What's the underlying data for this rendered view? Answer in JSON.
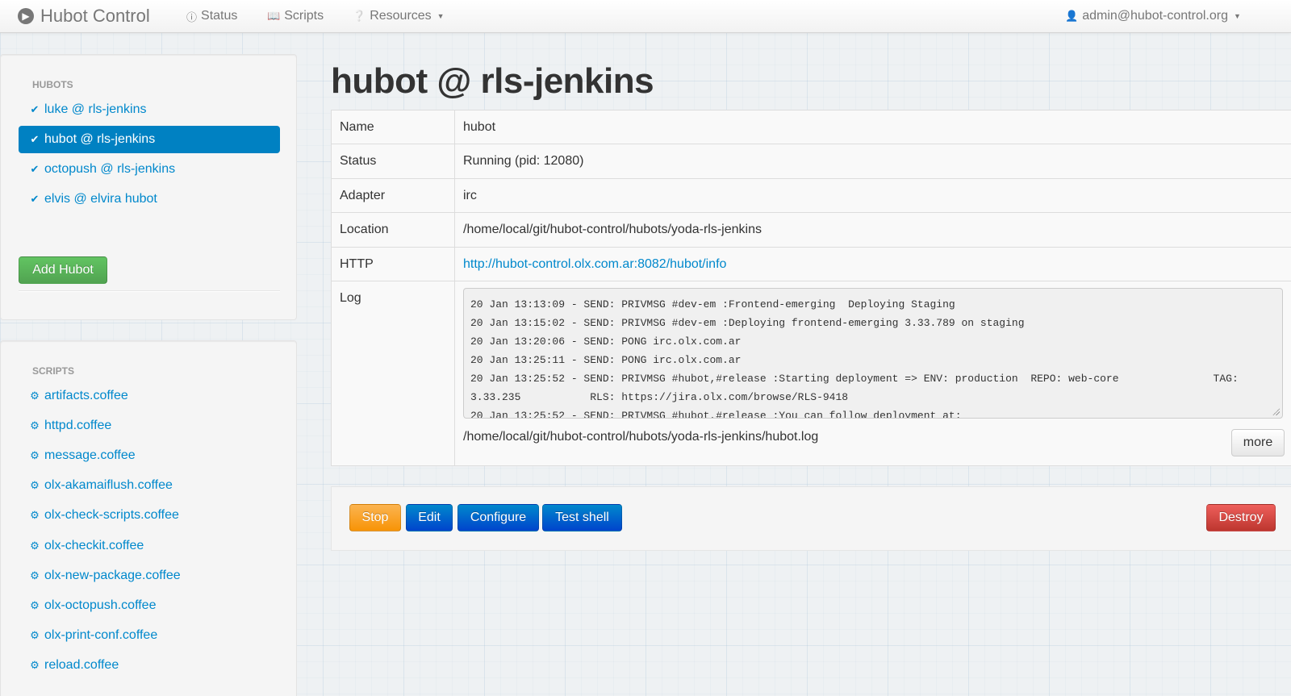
{
  "navbar": {
    "brand": "Hubot Control",
    "items": [
      {
        "label": "Status",
        "icon": "info-circle-icon"
      },
      {
        "label": "Scripts",
        "icon": "book-icon"
      },
      {
        "label": "Resources",
        "icon": "question-circle-icon"
      }
    ],
    "user": "admin@hubot-control.org"
  },
  "sidebar": {
    "hubots_header": "HUBOTS",
    "hubots": [
      {
        "label": "luke @ rls-jenkins",
        "active": false
      },
      {
        "label": "hubot @ rls-jenkins",
        "active": true
      },
      {
        "label": "octopush @ rls-jenkins",
        "active": false
      },
      {
        "label": "elvis @ elvira hubot",
        "active": false
      }
    ],
    "add_hubot_label": "Add Hubot",
    "scripts_header": "SCRIPTS",
    "scripts": [
      "artifacts.coffee",
      "httpd.coffee",
      "message.coffee",
      "olx-akamaiflush.coffee",
      "olx-check-scripts.coffee",
      "olx-checkit.coffee",
      "olx-new-package.coffee",
      "olx-octopush.coffee",
      "olx-print-conf.coffee",
      "reload.coffee"
    ]
  },
  "main": {
    "title": "hubot @ rls-jenkins",
    "details": {
      "name_label": "Name",
      "name_value": "hubot",
      "status_label": "Status",
      "status_value": "Running (pid: 12080)",
      "adapter_label": "Adapter",
      "adapter_value": "irc",
      "location_label": "Location",
      "location_value": "/home/local/git/hubot-control/hubots/yoda-rls-jenkins",
      "http_label": "HTTP",
      "http_value": "http://hubot-control.olx.com.ar:8082/hubot/info",
      "log_label": "Log"
    },
    "log_lines": [
      "20 Jan 13:13:09 - SEND: PRIVMSG #dev-em :Frontend-emerging  Deploying Staging",
      "20 Jan 13:15:02 - SEND: PRIVMSG #dev-em :Deploying frontend-emerging 3.33.789 on staging",
      "20 Jan 13:20:06 - SEND: PONG irc.olx.com.ar",
      "20 Jan 13:25:11 - SEND: PONG irc.olx.com.ar",
      "20 Jan 13:25:52 - SEND: PRIVMSG #hubot,#release :Starting deployment => ENV: production  REPO: web-core               TAG: 3.33.235           RLS: https://jira.olx.com/browse/RLS-9418",
      "20 Jan 13:25:52 - SEND: PRIVMSG #hubot,#release :You can follow deployment at:"
    ],
    "log_path": "/home/local/git/hubot-control/hubots/yoda-rls-jenkins/hubot.log",
    "more_label": "more",
    "actions": {
      "stop": "Stop",
      "edit": "Edit",
      "configure": "Configure",
      "test_shell": "Test shell",
      "destroy": "Destroy"
    }
  }
}
